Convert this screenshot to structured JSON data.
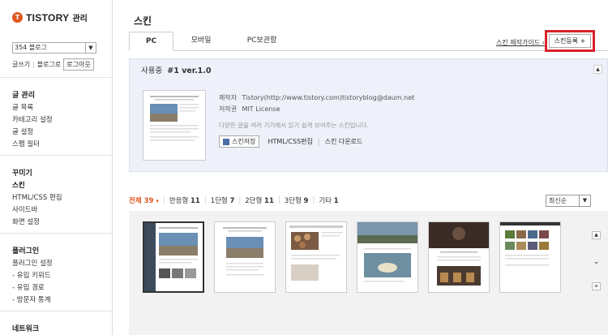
{
  "sidebar": {
    "brand_logo": "T",
    "brand": "TISTORY",
    "brand_sub": "관리",
    "blog_select": "354 블로그",
    "quick_write": "글쓰기",
    "quick_blog": "블로그로",
    "quick_logout": "로그아웃",
    "sections": [
      {
        "title": "글 관리",
        "items": [
          "글 목록",
          "카테고리 설정",
          "글 설정",
          "스팸 필터"
        ]
      },
      {
        "title": "꾸미기",
        "items": [
          "스킨",
          "HTML/CSS 편집",
          "사이드바",
          "화면 설정"
        ]
      },
      {
        "title": "플러그인",
        "items": [
          "플러그인 설정",
          "- 유입 키워드",
          "- 유입 경로",
          "- 방문자 통계"
        ]
      },
      {
        "title": "네트워크",
        "items": []
      }
    ]
  },
  "main": {
    "title": "스킨",
    "tabs": [
      "PC",
      "모바일",
      "PC보관함"
    ],
    "guide_link": "스킨 제작가이드",
    "register_button": "스킨등록 +",
    "current": {
      "status": "사용중",
      "name": "#1 ver.1.0",
      "maker_label": "제작자",
      "maker": "Tistory(http://www.tistory.com)tistoryblog@daum.net",
      "license_label": "저작권",
      "license": "MIT License",
      "description": "다양한 글을 여러 기기에서 읽기 쉽게 보여주는 스킨입니다.",
      "save_button": "스킨저장",
      "edit_link": "HTML/CSS편집",
      "download_link": "스킨 다운로드"
    },
    "filters": [
      {
        "label": "전체",
        "count": "39"
      },
      {
        "label": "반응형",
        "count": "11"
      },
      {
        "label": "1단형",
        "count": "7"
      },
      {
        "label": "2단형",
        "count": "11"
      },
      {
        "label": "3단형",
        "count": "9"
      },
      {
        "label": "기타",
        "count": "1"
      }
    ],
    "sort": "최신순"
  },
  "colors": {
    "accent": "#e0561f",
    "highlight": "#d8232a",
    "panel": "#eef0fa"
  }
}
